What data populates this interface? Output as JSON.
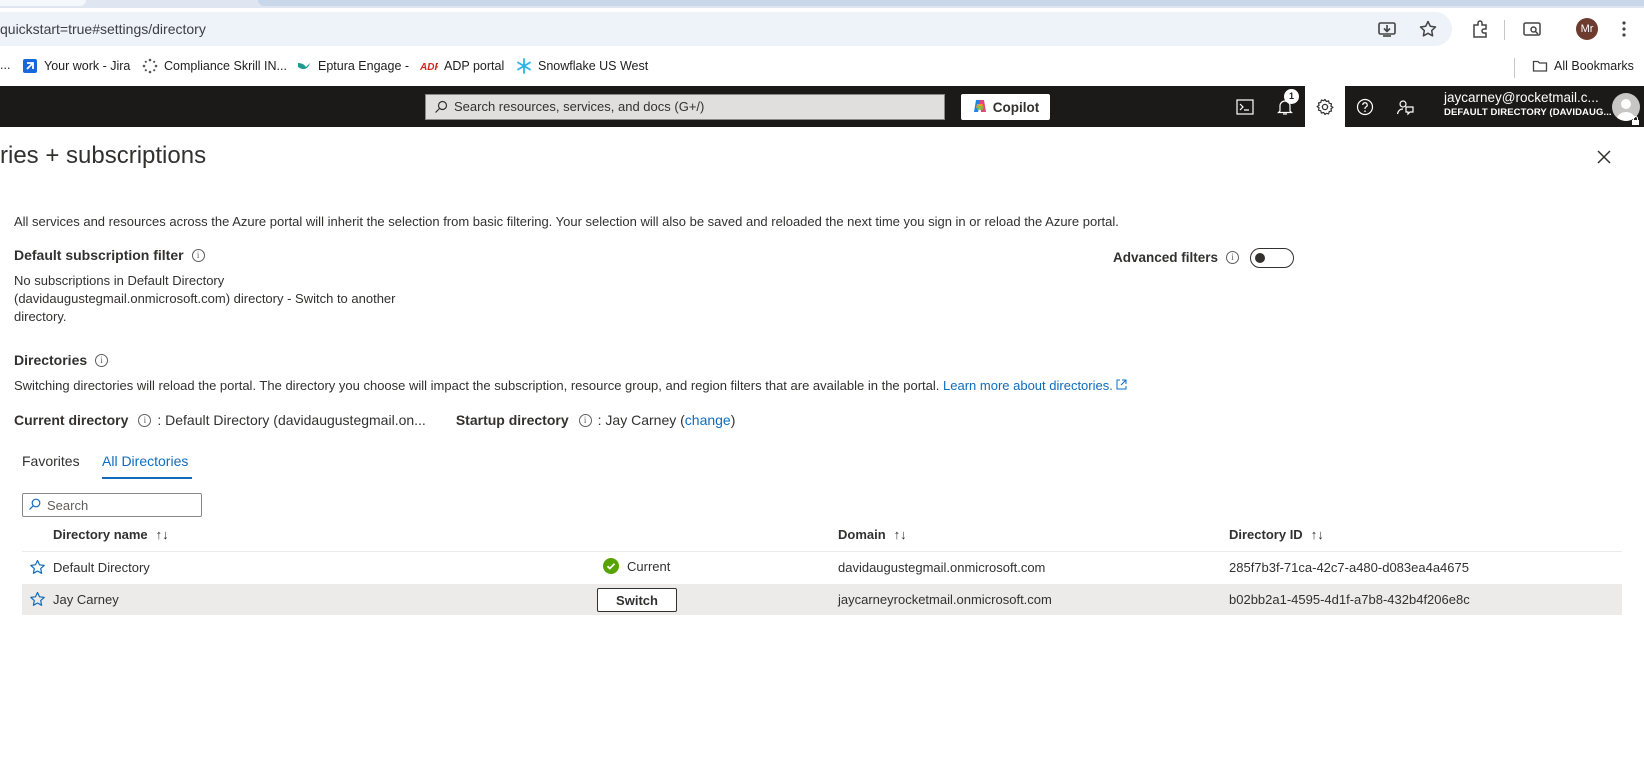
{
  "browser": {
    "url": "quickstart=true#settings/directory",
    "bookmarks": [
      "...",
      "Your work - Jira",
      "Compliance Skrill IN...",
      "Eptura Engage -",
      "ADP portal",
      "Snowflake US West"
    ],
    "all_bookmarks": "All Bookmarks",
    "profile_initials": "Mr"
  },
  "header": {
    "search_placeholder": "Search resources, services, and docs (G+/)",
    "copilot_label": "Copilot",
    "notification_count": "1",
    "account_email": "jaycarney@rocketmail.c...",
    "account_directory": "DEFAULT DIRECTORY (DAVIDAUG..."
  },
  "page": {
    "title": "ries + subscriptions",
    "intro": "All services and resources across the Azure portal will inherit the selection from basic filtering. Your selection will also be saved and reloaded the next time you sign in or reload the Azure portal.",
    "default_filter_label": "Default subscription filter",
    "no_subs_line1": "No subscriptions in Default Directory",
    "no_subs_line2": "(davidaugustegmail.onmicrosoft.com) directory - Switch to another",
    "no_subs_line3": "directory.",
    "advanced_filters_label": "Advanced filters",
    "advanced_filters_on": false,
    "directories_label": "Directories",
    "directories_desc": "Switching directories will reload the portal. The directory you choose will impact the subscription, resource group, and region filters that are available in the portal.",
    "learn_more": "Learn more about directories.",
    "current_dir_label": "Current directory",
    "current_dir_value": ": Default Directory (davidaugustegmail.on...",
    "startup_dir_label": "Startup directory",
    "startup_dir_value": ": Jay Carney (",
    "change_link": "change",
    "startup_dir_close": ")"
  },
  "tabs": [
    "Favorites",
    "All Directories"
  ],
  "active_tab": "All Directories",
  "search": {
    "placeholder": "Search"
  },
  "table": {
    "columns": [
      "Directory name",
      "Domain",
      "Directory ID"
    ],
    "rows": [
      {
        "name": "Default Directory",
        "status": "Current",
        "domain": "davidaugustegmail.onmicrosoft.com",
        "id": "285f7b3f-71ca-42c7-a480-d083ea4a4675"
      },
      {
        "name": "Jay Carney",
        "action": "Switch",
        "domain": "jaycarneyrocketmail.onmicrosoft.com",
        "id": "b02bb2a1-4595-4d1f-a7b8-432b4f206e8c"
      }
    ]
  },
  "colors": {
    "accent": "#0f6cbd",
    "header_bg": "#1b1a19",
    "success": "#57a300"
  }
}
